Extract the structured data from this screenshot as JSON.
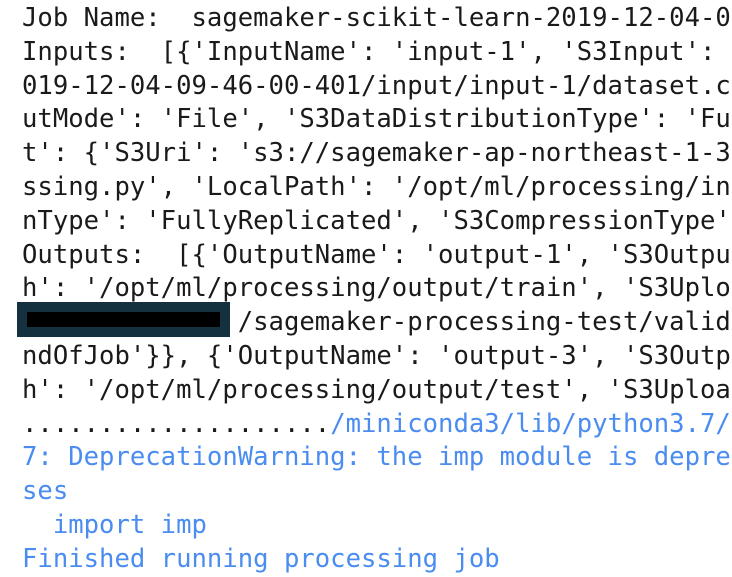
{
  "stdout": [
    "Job Name:  sagemaker-scikit-learn-2019-12-04-0",
    "Inputs:  [{'InputName': 'input-1', 'S3Input': ",
    "019-12-04-09-46-00-401/input/input-1/dataset.c",
    "utMode': 'File', 'S3DataDistributionType': 'Fu",
    "t': {'S3Uri': 's3://sagemaker-ap-northeast-1-3",
    "ssing.py', 'LocalPath': '/opt/ml/processing/in",
    "nType': 'FullyReplicated', 'S3CompressionType'",
    "Outputs:  [{'OutputName': 'output-1', 'S3Outpu",
    "h': '/opt/ml/processing/output/train', 'S3Uplo",
    "              /sagemaker-processing-test/valida",
    "ndOfJob'}}, {'OutputName': 'output-3', 'S3Outp",
    "h': '/opt/ml/processing/output/test', 'S3Uploa"
  ],
  "progress_dots": "....................",
  "stderr": {
    "path": "/miniconda3/lib/python3.7/",
    "lines": [
      "7: DeprecationWarning: the imp module is depre",
      "ses",
      "  import imp",
      "Finished running processing job"
    ]
  },
  "colors": {
    "warning_text": "#4a8cf0",
    "redaction": "#15303f"
  }
}
